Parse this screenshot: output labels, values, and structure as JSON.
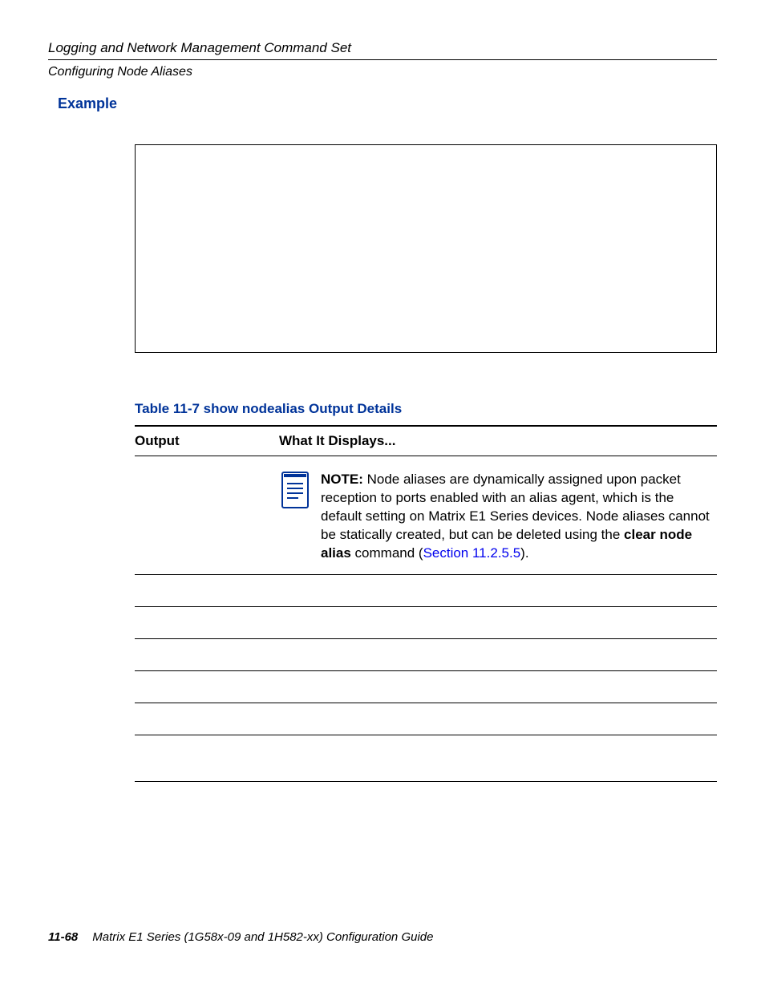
{
  "header": {
    "title": "Logging and Network Management Command Set",
    "subtitle": "Configuring Node Aliases"
  },
  "example_heading": "Example",
  "table": {
    "caption": "Table 11-7    show nodealias Output Details",
    "header_col1": "Output",
    "header_col2": "What It Displays...",
    "note": {
      "label": "NOTE:",
      "text_before_bold": "  Node aliases are dynamically assigned upon packet reception to ports enabled with an alias agent, which is the default setting on Matrix E1 Series devices. Node aliases cannot be statically created, but can be deleted using the ",
      "bold_cmd": "clear node alias",
      "after_bold": " command (",
      "link": "Section 11.2.5.5",
      "after_link": ")."
    }
  },
  "footer": {
    "page": "11-68",
    "text": "Matrix E1 Series (1G58x-09 and 1H582-xx) Configuration Guide"
  }
}
